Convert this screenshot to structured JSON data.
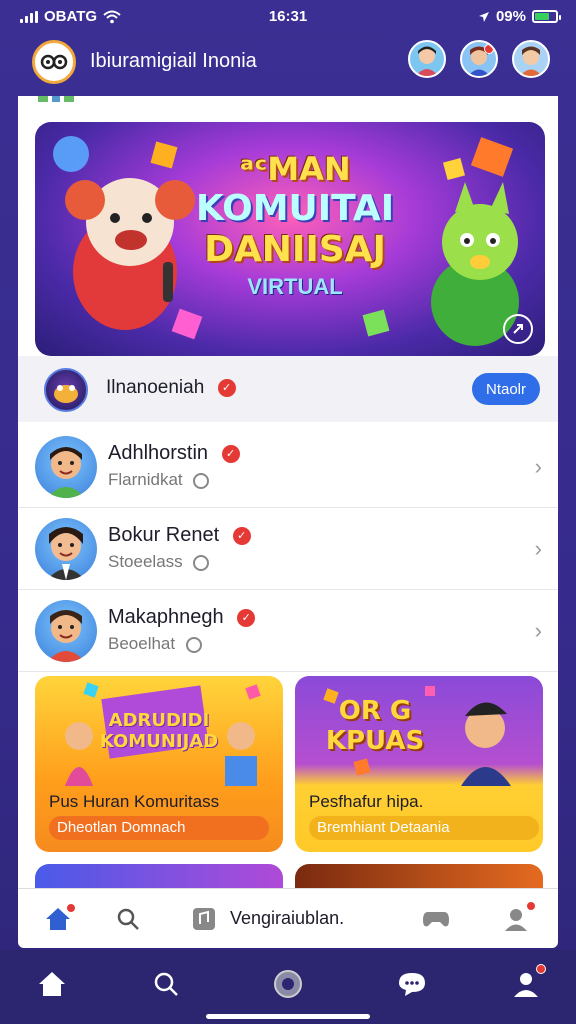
{
  "status_bar": {
    "carrier": "OBATG",
    "time": "16:31",
    "battery": "09%"
  },
  "header": {
    "title": "Ibiuramigiail Inonia",
    "app_logo_text": "ꙭ"
  },
  "hero": {
    "line1": "ᵃᶜMAN",
    "line2": "KOMUITAI",
    "line3": "DANIISAJ",
    "line4": "VIRTUAL",
    "expand_icon": "expand-icon"
  },
  "channel": {
    "name": "Ilnanoeniah",
    "button_label": "Ntaolr"
  },
  "list": [
    {
      "name": "Adhlhorstin",
      "sub": "Flarnidkat"
    },
    {
      "name": "Bokur Renet",
      "sub": "Stoeelass"
    },
    {
      "name": "Makaphnegh",
      "sub": "Beoelhat"
    }
  ],
  "promos": [
    {
      "art_text": "ADRUDIDI\nKOMUNIJAD",
      "title": "Pus Huran Komuritass",
      "subtitle": "Dheotlan Domnach"
    },
    {
      "art_text": "OR G\nKPUAS",
      "title": "Pesfhafur hipa.",
      "subtitle": "Bremhiant Detaania"
    }
  ],
  "subnav": {
    "label": "Vengiraiublan."
  },
  "colors": {
    "accent": "#2f6ee8",
    "brand_bg": "#3b2f93",
    "verified": "#e53935"
  }
}
